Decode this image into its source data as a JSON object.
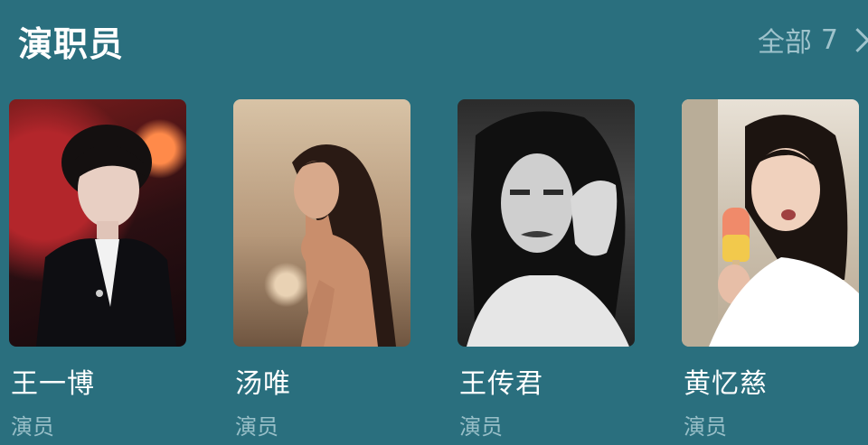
{
  "section": {
    "title": "演职员",
    "view_all_label": "全部",
    "view_all_count": "7"
  },
  "cast": [
    {
      "name": "王一博",
      "role": "演员"
    },
    {
      "name": "汤唯",
      "role": "演员"
    },
    {
      "name": "王传君",
      "role": "演员"
    },
    {
      "name": "黄忆慈",
      "role": "演员"
    }
  ],
  "colors": {
    "background": "#2a6f7e",
    "secondary_text": "#98bfc8"
  },
  "icons": {
    "view_all_chevron": "chevron-right-icon"
  }
}
